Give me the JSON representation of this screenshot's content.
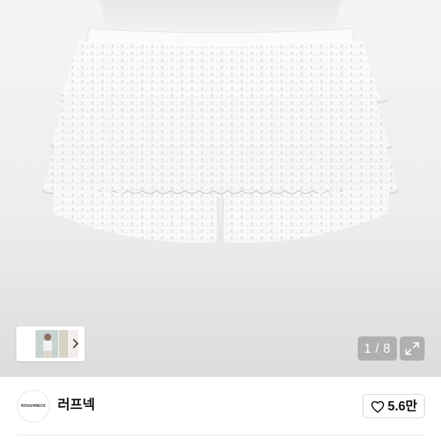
{
  "gallery": {
    "counter": "1 / 8",
    "expand_icon": "expand-icon",
    "thumbnail_chevron": "chevron-right-icon"
  },
  "brand": {
    "logo_text": "ROUGHNECK",
    "name": "러프넥"
  },
  "like": {
    "icon": "heart-outline-icon",
    "count": "5.6만"
  }
}
